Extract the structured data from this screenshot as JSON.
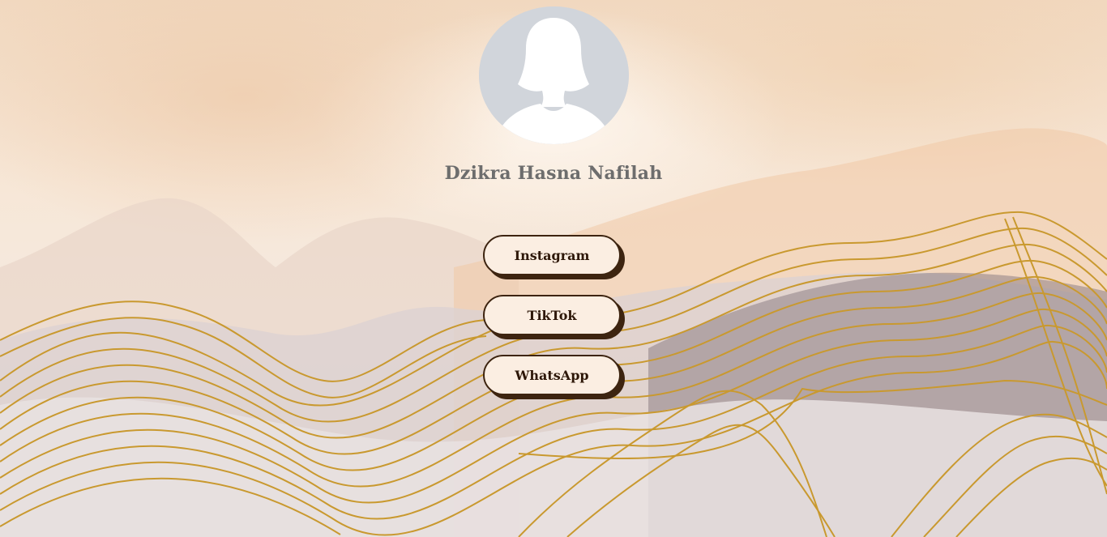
{
  "profile": {
    "name": "Dzikra Hasna Nafilah",
    "avatar_icon": "user-silhouette-icon"
  },
  "links": [
    {
      "label": "Instagram"
    },
    {
      "label": "TikTok"
    },
    {
      "label": "WhatsApp"
    }
  ],
  "colors": {
    "button_bg": "#fbeee2",
    "button_border": "#3d2410",
    "name_text": "#6d6d6d",
    "gold_lines": "#c9992f",
    "avatar_bg": "#d1d5db"
  }
}
